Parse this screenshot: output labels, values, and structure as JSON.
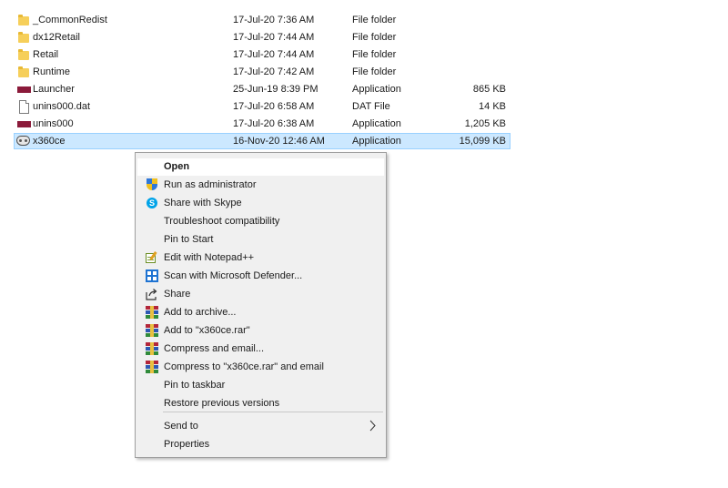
{
  "files": [
    {
      "name": "_CommonRedist",
      "date": "17-Jul-20 7:36 AM",
      "type": "File folder",
      "size": "",
      "icon": "folder-icon",
      "selected": false
    },
    {
      "name": "dx12Retail",
      "date": "17-Jul-20 7:44 AM",
      "type": "File folder",
      "size": "",
      "icon": "folder-icon",
      "selected": false
    },
    {
      "name": "Retail",
      "date": "17-Jul-20 7:44 AM",
      "type": "File folder",
      "size": "",
      "icon": "folder-icon",
      "selected": false
    },
    {
      "name": "Runtime",
      "date": "17-Jul-20 7:42 AM",
      "type": "File folder",
      "size": "",
      "icon": "folder-icon",
      "selected": false
    },
    {
      "name": "Launcher",
      "date": "25-Jun-19 8:39 PM",
      "type": "Application",
      "size": "865 KB",
      "icon": "application-icon",
      "selected": false
    },
    {
      "name": "unins000.dat",
      "date": "17-Jul-20 6:58 AM",
      "type": "DAT File",
      "size": "14 KB",
      "icon": "document-icon",
      "selected": false
    },
    {
      "name": "unins000",
      "date": "17-Jul-20 6:38 AM",
      "type": "Application",
      "size": "1,205 KB",
      "icon": "application-icon",
      "selected": false
    },
    {
      "name": "x360ce",
      "date": "16-Nov-20 12:46 AM",
      "type": "Application",
      "size": "15,099 KB",
      "icon": "gamepad-icon",
      "selected": true
    }
  ],
  "context_menu": {
    "items": [
      {
        "label": "Open",
        "icon": "",
        "bold": true,
        "hover": true
      },
      {
        "label": "Run as administrator",
        "icon": "uac-shield-icon"
      },
      {
        "label": "Share with Skype",
        "icon": "skype-icon"
      },
      {
        "label": "Troubleshoot compatibility",
        "icon": ""
      },
      {
        "label": "Pin to Start",
        "icon": ""
      },
      {
        "label": "Edit with Notepad++",
        "icon": "notepad-plus-plus-icon"
      },
      {
        "label": "Scan with Microsoft Defender...",
        "icon": "defender-icon"
      },
      {
        "label": "Share",
        "icon": "share-icon"
      },
      {
        "label": "Add to archive...",
        "icon": "winrar-icon"
      },
      {
        "label": "Add to \"x360ce.rar\"",
        "icon": "winrar-icon"
      },
      {
        "label": "Compress and email...",
        "icon": "winrar-icon"
      },
      {
        "label": "Compress to \"x360ce.rar\" and email",
        "icon": "winrar-icon"
      },
      {
        "label": "Pin to taskbar",
        "icon": ""
      },
      {
        "label": "Restore previous versions",
        "icon": ""
      },
      {
        "label": "Send to",
        "icon": "",
        "submenu": true
      },
      {
        "label": "Properties",
        "icon": ""
      }
    ]
  },
  "colors": {
    "selection_background": "#cce8ff",
    "selection_border": "#99d1ff",
    "menu_background": "#f0f0f0",
    "menu_hover": "#ffffff"
  }
}
